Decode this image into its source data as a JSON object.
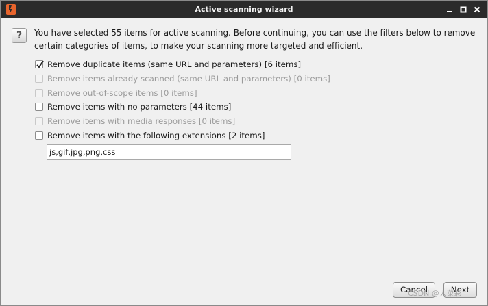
{
  "window": {
    "title": "Active scanning wizard"
  },
  "message": "You have selected 55 items for active scanning. Before continuing, you can use the filters below to remove certain categories of items, to make your scanning more targeted and efficient.",
  "options": [
    {
      "label": "Remove duplicate items (same URL and parameters) [6 items]",
      "checked": true,
      "enabled": true
    },
    {
      "label": "Remove items already scanned (same URL and parameters) [0 items]",
      "checked": false,
      "enabled": false
    },
    {
      "label": "Remove out-of-scope items [0 items]",
      "checked": false,
      "enabled": false
    },
    {
      "label": "Remove items with no parameters [44 items]",
      "checked": false,
      "enabled": true
    },
    {
      "label": "Remove items with media responses [0 items]",
      "checked": false,
      "enabled": false
    },
    {
      "label": "Remove items with the following extensions [2 items]",
      "checked": false,
      "enabled": true
    }
  ],
  "extensions_input": {
    "value": "js,gif,jpg,png,css"
  },
  "buttons": {
    "cancel": "Cancel",
    "next": "Next"
  },
  "watermark": "CSDN @大菜彩"
}
